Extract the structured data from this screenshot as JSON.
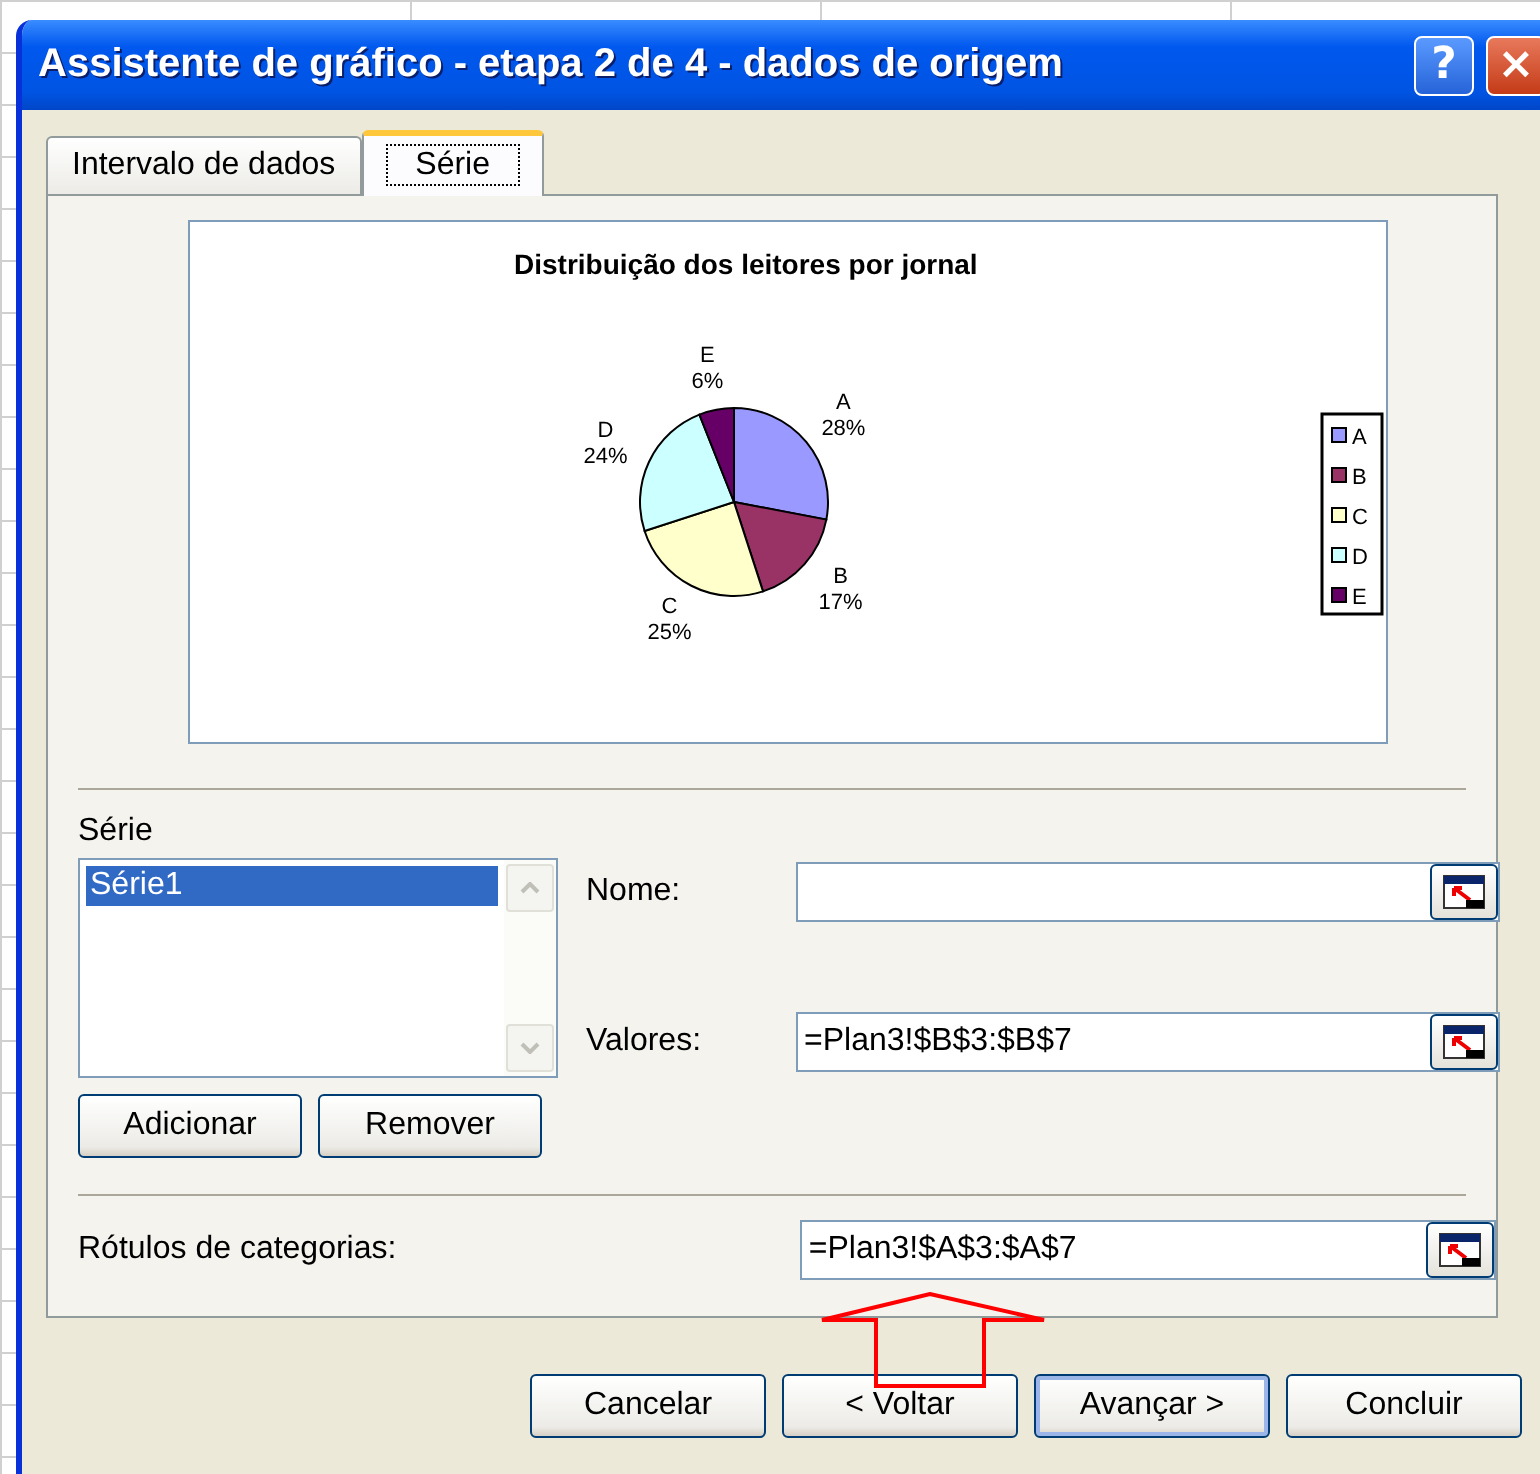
{
  "window": {
    "title": "Assistente de gráfico - etapa 2 de 4 - dados de origem",
    "title_buttons": [
      "?",
      "×"
    ]
  },
  "tabs": [
    {
      "label": "Intervalo de dados",
      "selected": false
    },
    {
      "label": "Série",
      "selected": true
    }
  ],
  "preview": {
    "chart_data": {
      "type": "pie",
      "title": "Distribuição dos leitores por jornal",
      "categories": [
        "A",
        "B",
        "C",
        "D",
        "E"
      ],
      "series": [
        {
          "values": [
            28,
            17,
            25,
            24,
            6
          ]
        }
      ],
      "colors": [
        "#9999ff",
        "#993366",
        "#ffffcc",
        "#ccffff",
        "#660066"
      ],
      "value_labels": [
        "28%",
        "17%",
        "25%",
        "24%",
        "6%"
      ],
      "legend": true
    }
  },
  "series_section": {
    "label": "Série",
    "items": [
      {
        "label": "Série1",
        "selected": true
      }
    ],
    "buttons": [
      "Adicionar",
      "Remover"
    ],
    "fields": [
      {
        "label": "Nome:"
      },
      {
        "label": "Valores:",
        "value": "=Plan3!$B$3:$B$7"
      }
    ]
  },
  "categories_field": {
    "label": "Rótulos de categorias:",
    "value": "=Plan3!$A$3:$A$7"
  },
  "buttons": [
    {
      "label": "Cancelar",
      "default": false
    },
    {
      "label": "< Voltar",
      "default": false
    },
    {
      "label": "Avançar >",
      "default": true
    },
    {
      "label": "Concluir",
      "default": false
    }
  ]
}
